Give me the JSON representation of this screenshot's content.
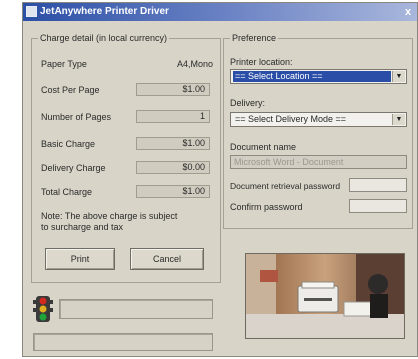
{
  "window": {
    "title": "JetAnywhere Printer Driver",
    "close_glyph": "x"
  },
  "charge": {
    "legend": "Charge detail (in local currency)",
    "paper_type_label": "Paper Type",
    "paper_type_value": "A4,Mono",
    "cost_per_page_label": "Cost Per Page",
    "cost_per_page_value": "$1.00",
    "pages_label": "Number of Pages",
    "pages_value": "1",
    "basic_label": "Basic Charge",
    "basic_value": "$1.00",
    "delivery_label": "Delivery Charge",
    "delivery_value": "$0.00",
    "total_label": "Total Charge",
    "total_value": "$1.00",
    "note": "Note: The above charge is subject to surcharge and tax"
  },
  "buttons": {
    "print": "Print",
    "cancel": "Cancel"
  },
  "preference": {
    "legend": "Preference",
    "location_label": "Printer location:",
    "location_value": "== Select Location ==",
    "delivery_label": "Delivery:",
    "delivery_value": "== Select Delivery Mode ==",
    "docname_label": "Document name",
    "docname_value": "Microsoft Word - Document",
    "retrieval_pw_label": "Document retrieval password",
    "confirm_pw_label": "Confirm password"
  },
  "icons": {
    "status": "traffic-light-icon",
    "dropdown": "dropdown-arrow-icon",
    "image": "printer-photo"
  },
  "colors": {
    "titlebar": "#2b4fa6",
    "selection": "#2a4ea8",
    "traffic_red": "#d22a1e",
    "traffic_green": "#1fa43a"
  }
}
